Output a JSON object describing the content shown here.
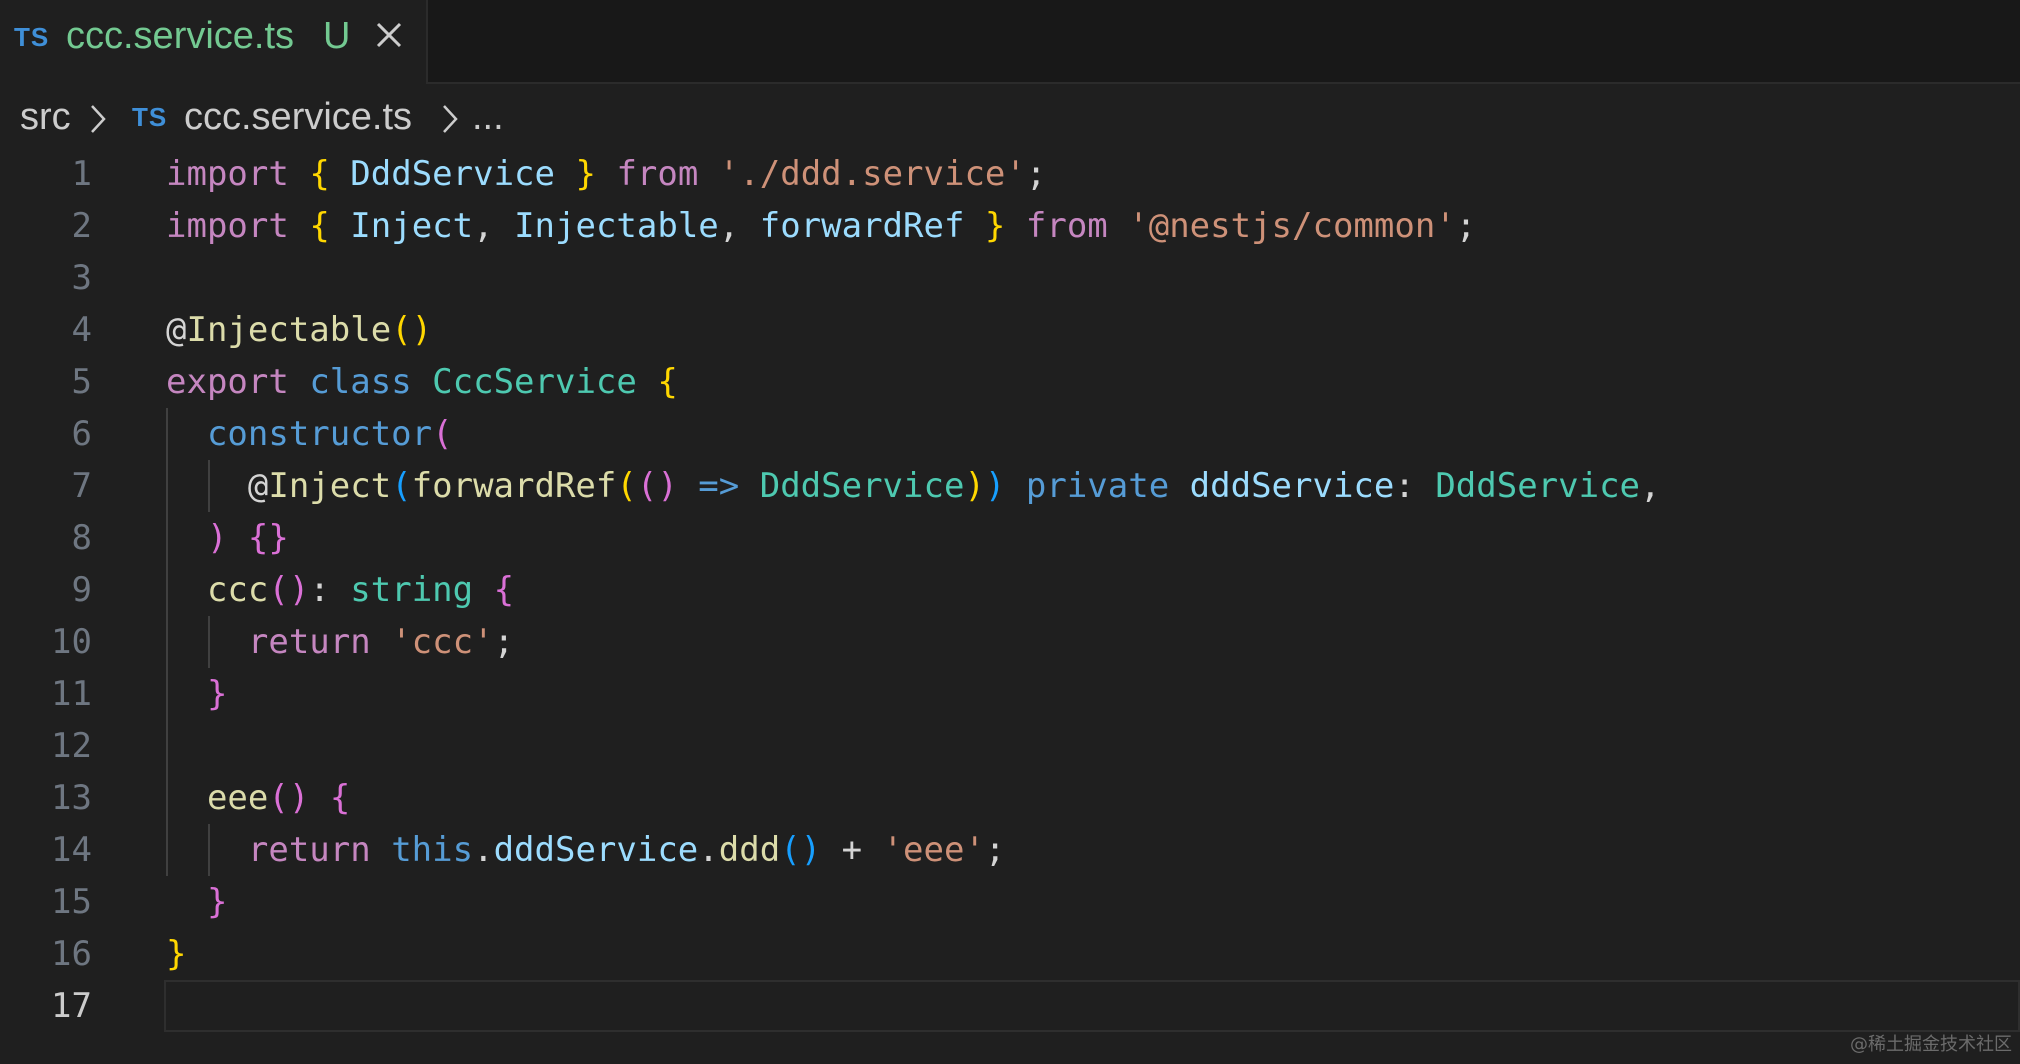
{
  "tab": {
    "language_badge": "TS",
    "title": "ccc.service.ts",
    "status": "U",
    "close_icon": "close-icon"
  },
  "breadcrumb": {
    "folder": "src",
    "separator_icon": "chevron-right-icon",
    "language_badge": "TS",
    "file": "ccc.service.ts",
    "more": "..."
  },
  "editor": {
    "language": "typescript",
    "active_line": 17,
    "line_numbers": [
      "1",
      "2",
      "3",
      "4",
      "5",
      "6",
      "7",
      "8",
      "9",
      "10",
      "11",
      "12",
      "13",
      "14",
      "15",
      "16",
      "17"
    ],
    "lines": [
      [
        [
          "kw",
          "import"
        ],
        [
          "pl",
          " "
        ],
        [
          "p1",
          "{"
        ],
        [
          "pl",
          " "
        ],
        [
          "va",
          "DddService"
        ],
        [
          "pl",
          " "
        ],
        [
          "p1",
          "}"
        ],
        [
          "pl",
          " "
        ],
        [
          "kw",
          "from"
        ],
        [
          "pl",
          " "
        ],
        [
          "st",
          "'./ddd.service'"
        ],
        [
          "pl",
          ";"
        ]
      ],
      [
        [
          "kw",
          "import"
        ],
        [
          "pl",
          " "
        ],
        [
          "p1",
          "{"
        ],
        [
          "pl",
          " "
        ],
        [
          "va",
          "Inject"
        ],
        [
          "pl",
          ", "
        ],
        [
          "va",
          "Injectable"
        ],
        [
          "pl",
          ", "
        ],
        [
          "va",
          "forwardRef"
        ],
        [
          "pl",
          " "
        ],
        [
          "p1",
          "}"
        ],
        [
          "pl",
          " "
        ],
        [
          "kw",
          "from"
        ],
        [
          "pl",
          " "
        ],
        [
          "st",
          "'@nestjs/common'"
        ],
        [
          "pl",
          ";"
        ]
      ],
      [],
      [
        [
          "pl",
          "@"
        ],
        [
          "fn",
          "Injectable"
        ],
        [
          "p1",
          "()"
        ]
      ],
      [
        [
          "kw",
          "export"
        ],
        [
          "pl",
          " "
        ],
        [
          "bl",
          "class"
        ],
        [
          "pl",
          " "
        ],
        [
          "ty",
          "CccService"
        ],
        [
          "pl",
          " "
        ],
        [
          "p1",
          "{"
        ]
      ],
      [
        [
          "pl",
          "  "
        ],
        [
          "bl",
          "constructor"
        ],
        [
          "p2",
          "("
        ]
      ],
      [
        [
          "pl",
          "    @"
        ],
        [
          "fn",
          "Inject"
        ],
        [
          "p3",
          "("
        ],
        [
          "fn",
          "forwardRef"
        ],
        [
          "p1",
          "("
        ],
        [
          "p2",
          "()"
        ],
        [
          "pl",
          " "
        ],
        [
          "bl",
          "=>"
        ],
        [
          "pl",
          " "
        ],
        [
          "ty",
          "DddService"
        ],
        [
          "p1",
          ")"
        ],
        [
          "p3",
          ")"
        ],
        [
          "pl",
          " "
        ],
        [
          "bl",
          "private"
        ],
        [
          "pl",
          " "
        ],
        [
          "va",
          "dddService"
        ],
        [
          "pl",
          ": "
        ],
        [
          "ty",
          "DddService"
        ],
        [
          "pl",
          ","
        ]
      ],
      [
        [
          "pl",
          "  "
        ],
        [
          "p2",
          ")"
        ],
        [
          "pl",
          " "
        ],
        [
          "p2",
          "{}"
        ]
      ],
      [
        [
          "pl",
          "  "
        ],
        [
          "fn",
          "ccc"
        ],
        [
          "p2",
          "()"
        ],
        [
          "pl",
          ": "
        ],
        [
          "ty",
          "string"
        ],
        [
          "pl",
          " "
        ],
        [
          "p2",
          "{"
        ]
      ],
      [
        [
          "pl",
          "    "
        ],
        [
          "kw",
          "return"
        ],
        [
          "pl",
          " "
        ],
        [
          "st",
          "'ccc'"
        ],
        [
          "pl",
          ";"
        ]
      ],
      [
        [
          "pl",
          "  "
        ],
        [
          "p2",
          "}"
        ]
      ],
      [],
      [
        [
          "pl",
          "  "
        ],
        [
          "fn",
          "eee"
        ],
        [
          "p2",
          "()"
        ],
        [
          "pl",
          " "
        ],
        [
          "p2",
          "{"
        ]
      ],
      [
        [
          "pl",
          "    "
        ],
        [
          "kw",
          "return"
        ],
        [
          "pl",
          " "
        ],
        [
          "bl",
          "this"
        ],
        [
          "pl",
          "."
        ],
        [
          "va",
          "dddService"
        ],
        [
          "pl",
          "."
        ],
        [
          "fn",
          "ddd"
        ],
        [
          "p3",
          "()"
        ],
        [
          "pl",
          " + "
        ],
        [
          "st",
          "'eee'"
        ],
        [
          "pl",
          ";"
        ]
      ],
      [
        [
          "pl",
          "  "
        ],
        [
          "p2",
          "}"
        ]
      ],
      [
        [
          "p1",
          "}"
        ]
      ],
      []
    ]
  },
  "watermark": "@稀土掘金技术社区"
}
